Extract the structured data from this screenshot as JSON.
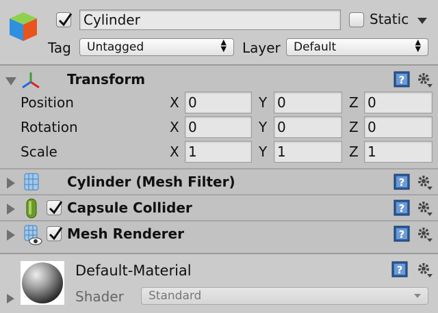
{
  "header": {
    "object_name": "Cylinder",
    "static_label": "Static",
    "active_checked": true,
    "static_checked": false,
    "tag_label": "Tag",
    "tag_value": "Untagged",
    "layer_label": "Layer",
    "layer_value": "Default"
  },
  "transform": {
    "title": "Transform",
    "rows": [
      {
        "label": "Position",
        "x": "0",
        "y": "0",
        "z": "0"
      },
      {
        "label": "Rotation",
        "x": "0",
        "y": "0",
        "z": "0"
      },
      {
        "label": "Scale",
        "x": "1",
        "y": "1",
        "z": "1"
      }
    ],
    "axis_labels": {
      "x": "X",
      "y": "Y",
      "z": "Z"
    }
  },
  "components": [
    {
      "title": "Cylinder (Mesh Filter)",
      "has_checkbox": false
    },
    {
      "title": "Capsule Collider",
      "has_checkbox": true
    },
    {
      "title": "Mesh Renderer",
      "has_checkbox": true
    }
  ],
  "material": {
    "name": "Default-Material",
    "shader_label": "Shader",
    "shader_value": "Standard"
  },
  "colors": {
    "panel_bg": "#c2c2c2",
    "header_bg": "#cbcbcb",
    "help_icon_blue": "#2a5d9f",
    "collider_green": "#6a9a2a"
  },
  "icons": [
    "cube-icon",
    "transform-axes-icon",
    "mesh-filter-icon",
    "capsule-collider-icon",
    "mesh-renderer-icon",
    "help-icon",
    "gear-icon",
    "material-sphere-icon"
  ]
}
